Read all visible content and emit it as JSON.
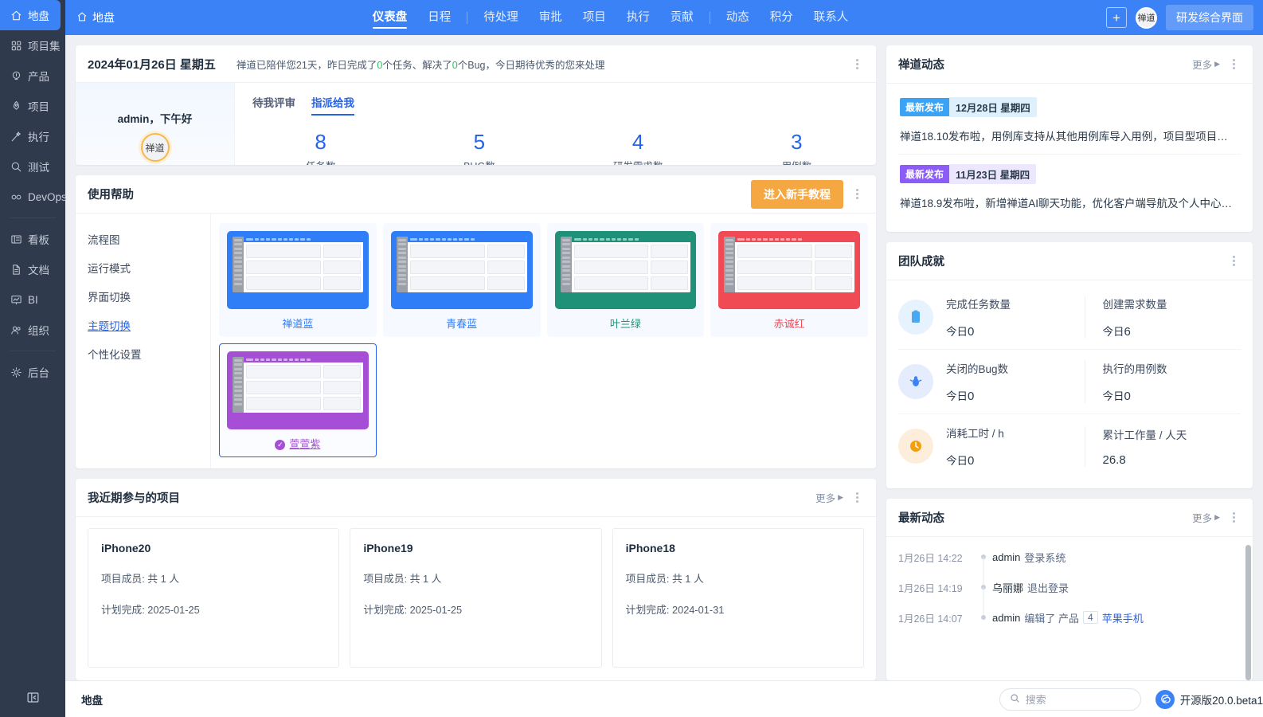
{
  "sidebar": {
    "items": [
      {
        "label": "地盘",
        "icon": "home-icon",
        "active": true
      },
      {
        "label": "项目集",
        "icon": "grid-icon",
        "active": false
      },
      {
        "label": "产品",
        "icon": "bulb-icon",
        "active": false
      },
      {
        "label": "项目",
        "icon": "rocket-icon",
        "active": false
      },
      {
        "label": "执行",
        "icon": "wand-icon",
        "active": false
      },
      {
        "label": "测试",
        "icon": "magnifier-icon",
        "active": false
      },
      {
        "label": "DevOps",
        "icon": "infinity-icon",
        "active": false
      },
      {
        "label": "看板",
        "icon": "board-icon",
        "active": false,
        "divider_before": true
      },
      {
        "label": "文档",
        "icon": "doc-icon",
        "active": false
      },
      {
        "label": "BI",
        "icon": "chart-icon",
        "active": false
      },
      {
        "label": "组织",
        "icon": "users-icon",
        "active": false
      },
      {
        "label": "后台",
        "icon": "gear-icon",
        "active": false,
        "divider_before": true
      }
    ],
    "collapse_icon": "collapse-panel-icon"
  },
  "topbar": {
    "breadcrumb": "地盘",
    "breadcrumb_icon": "home-icon",
    "nav": [
      {
        "label": "仪表盘",
        "active": true
      },
      {
        "label": "日程",
        "active": false
      },
      {
        "label": "待处理",
        "active": false,
        "divider_before": true
      },
      {
        "label": "审批",
        "active": false
      },
      {
        "label": "项目",
        "active": false
      },
      {
        "label": "执行",
        "active": false
      },
      {
        "label": "贡献",
        "active": false
      },
      {
        "label": "动态",
        "active": false,
        "divider_before": true
      },
      {
        "label": "积分",
        "active": false
      },
      {
        "label": "联系人",
        "active": false
      }
    ],
    "add_button": "+",
    "avatar_text": "禅道",
    "ui_button": "研发综合界面",
    "accent": "#3b82f6"
  },
  "greeting": {
    "date": "2024年01月26日 星期五",
    "message_pre": "禅道已陪伴您21天，昨日完成了",
    "message_n1": "0",
    "message_mid": "个任务、解决了",
    "message_n2": "0",
    "message_post": "个Bug，今日期待优秀的您来处理",
    "user_greeting": "admin，下午好",
    "avatar_text": "禅道",
    "tabs": [
      {
        "label": "待我评审",
        "active": false
      },
      {
        "label": "指派给我",
        "active": true
      }
    ],
    "stats": [
      {
        "value": "8",
        "label": "任务数"
      },
      {
        "value": "5",
        "label": "BUG数"
      },
      {
        "value": "4",
        "label": "研发需求数"
      },
      {
        "value": "3",
        "label": "用例数"
      }
    ]
  },
  "help": {
    "title": "使用帮助",
    "tutorial_button": "进入新手教程",
    "menu": [
      {
        "label": "流程图",
        "active": false
      },
      {
        "label": "运行模式",
        "active": false
      },
      {
        "label": "界面切换",
        "active": false
      },
      {
        "label": "主题切换",
        "active": true
      },
      {
        "label": "个性化设置",
        "active": false
      }
    ],
    "themes": [
      {
        "name": "禅道蓝",
        "color": "#2f7ef7",
        "selected": false
      },
      {
        "name": "青春蓝",
        "color": "#2f7ef7",
        "selected": false
      },
      {
        "name": "叶兰绿",
        "color": "#1f9178",
        "selected": false
      },
      {
        "name": "赤诚红",
        "color": "#f04a54",
        "selected": false
      },
      {
        "name": "萱萱紫",
        "color": "#a64fd6",
        "selected": true
      }
    ]
  },
  "projects": {
    "title": "我近期参与的项目",
    "more": "更多",
    "items": [
      {
        "name": "iPhone20",
        "members": "项目成员: 共 1 人",
        "plan": "计划完成: 2025-01-25"
      },
      {
        "name": "iPhone19",
        "members": "项目成员: 共 1 人",
        "plan": "计划完成: 2025-01-25"
      },
      {
        "name": "iPhone18",
        "members": "项目成员: 共 1 人",
        "plan": "计划完成: 2024-01-31"
      }
    ]
  },
  "news": {
    "title": "禅道动态",
    "more": "更多",
    "items": [
      {
        "tag": "最新发布",
        "tag_color": "#3ba3f5",
        "date_bg": "#dff0fd",
        "date": "12月28日 星期四",
        "text": "禅道18.10发布啦，用例库支持从其他用例库导入用例，项目型项目…"
      },
      {
        "tag": "最新发布",
        "tag_color": "#8b5cf6",
        "date_bg": "#ece7fd",
        "date": "11月23日 星期四",
        "text": "禅道18.9发布啦，新增禅道AI聊天功能，优化客户端导航及个人中心…"
      }
    ]
  },
  "achievements": {
    "title": "团队成就",
    "rows": [
      {
        "medal_icon": "clipboard-medal-icon",
        "medal_color": "#4aa8f0",
        "medal_bg": "#e6f3fe",
        "left": {
          "label": "完成任务数量",
          "prefix": "今日",
          "value": "0"
        },
        "right": {
          "label": "创建需求数量",
          "prefix": "今日",
          "value": "6"
        }
      },
      {
        "medal_icon": "bug-medal-icon",
        "medal_color": "#3b82f6",
        "medal_bg": "#e4ecfe",
        "left": {
          "label": "关闭的Bug数",
          "prefix": "今日",
          "value": "0"
        },
        "right": {
          "label": "执行的用例数",
          "prefix": "今日",
          "value": "0"
        }
      },
      {
        "medal_icon": "clock-medal-icon",
        "medal_color": "#f59e0b",
        "medal_bg": "#fdeedb",
        "left": {
          "label": "消耗工时 / h",
          "prefix": "今日",
          "value": "0"
        },
        "right": {
          "label": "累计工作量 / 人天",
          "prefix": "",
          "value": "26.8"
        }
      }
    ]
  },
  "activity": {
    "title": "最新动态",
    "more": "更多",
    "items": [
      {
        "time": "1月26日 14:22",
        "user": "admin",
        "action": "登录系统",
        "id": "",
        "object": ""
      },
      {
        "time": "1月26日 14:19",
        "user": "乌丽娜",
        "action": "退出登录",
        "id": "",
        "object": ""
      },
      {
        "time": "1月26日 14:07",
        "user": "admin",
        "action": "编辑了 产品",
        "id": "4",
        "object": "苹果手机"
      }
    ]
  },
  "footer": {
    "title": "地盘",
    "search_placeholder": "搜索",
    "search_icon": "search-icon",
    "version": "开源版20.0.beta1"
  }
}
